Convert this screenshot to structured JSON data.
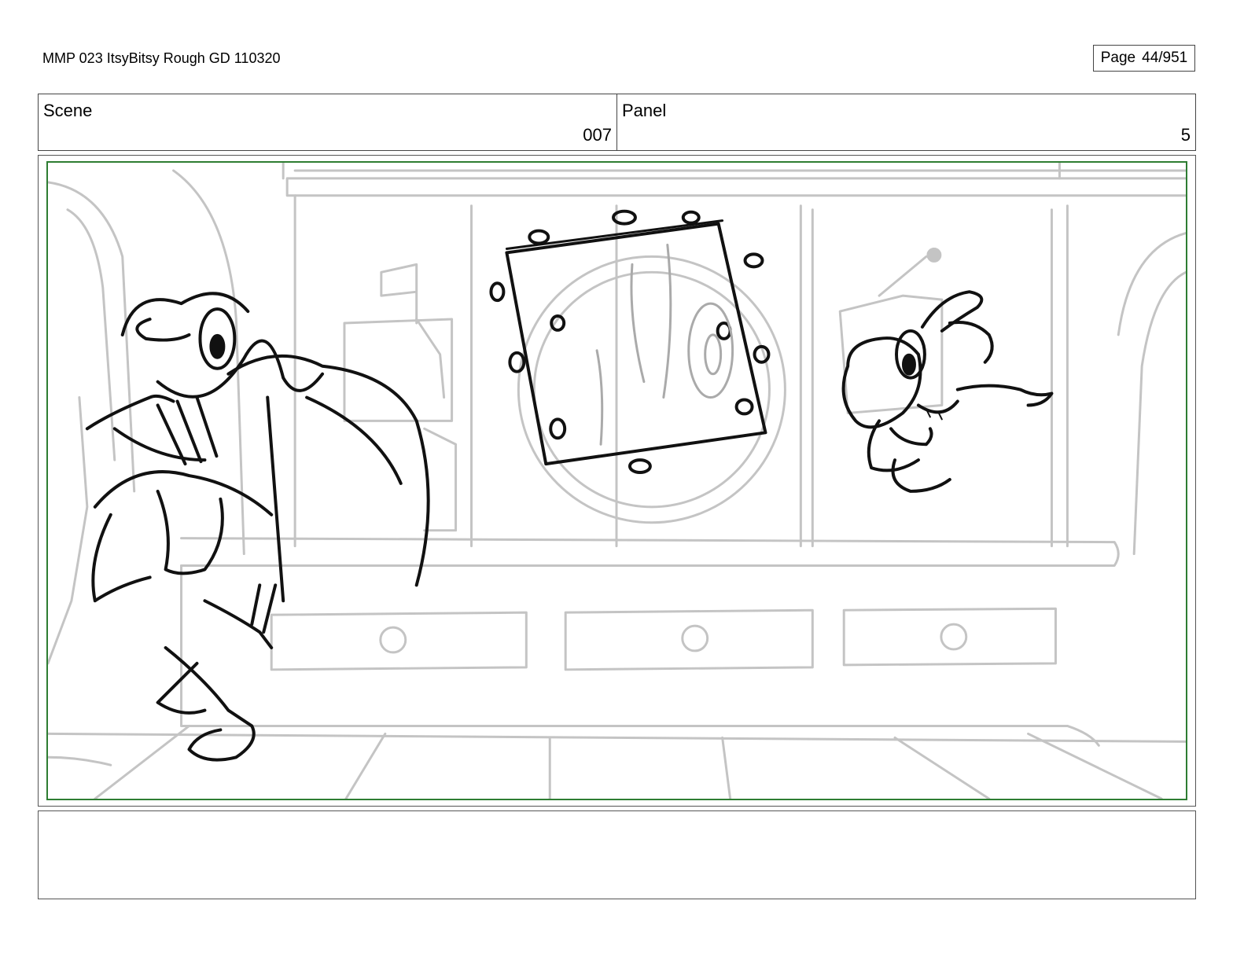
{
  "header": {
    "doc_title": "MMP 023 ItsyBitsy Rough GD 110320",
    "page_label": "Page",
    "page_number": "44/951"
  },
  "info": {
    "scene_label": "Scene",
    "scene_value": "007",
    "panel_label": "Panel",
    "panel_value": "5"
  },
  "frame": {
    "border_color": "#2e7d32",
    "background_line_color": "#c4c4c4",
    "character_line_color": "#111111"
  },
  "notes": {
    "text": ""
  }
}
